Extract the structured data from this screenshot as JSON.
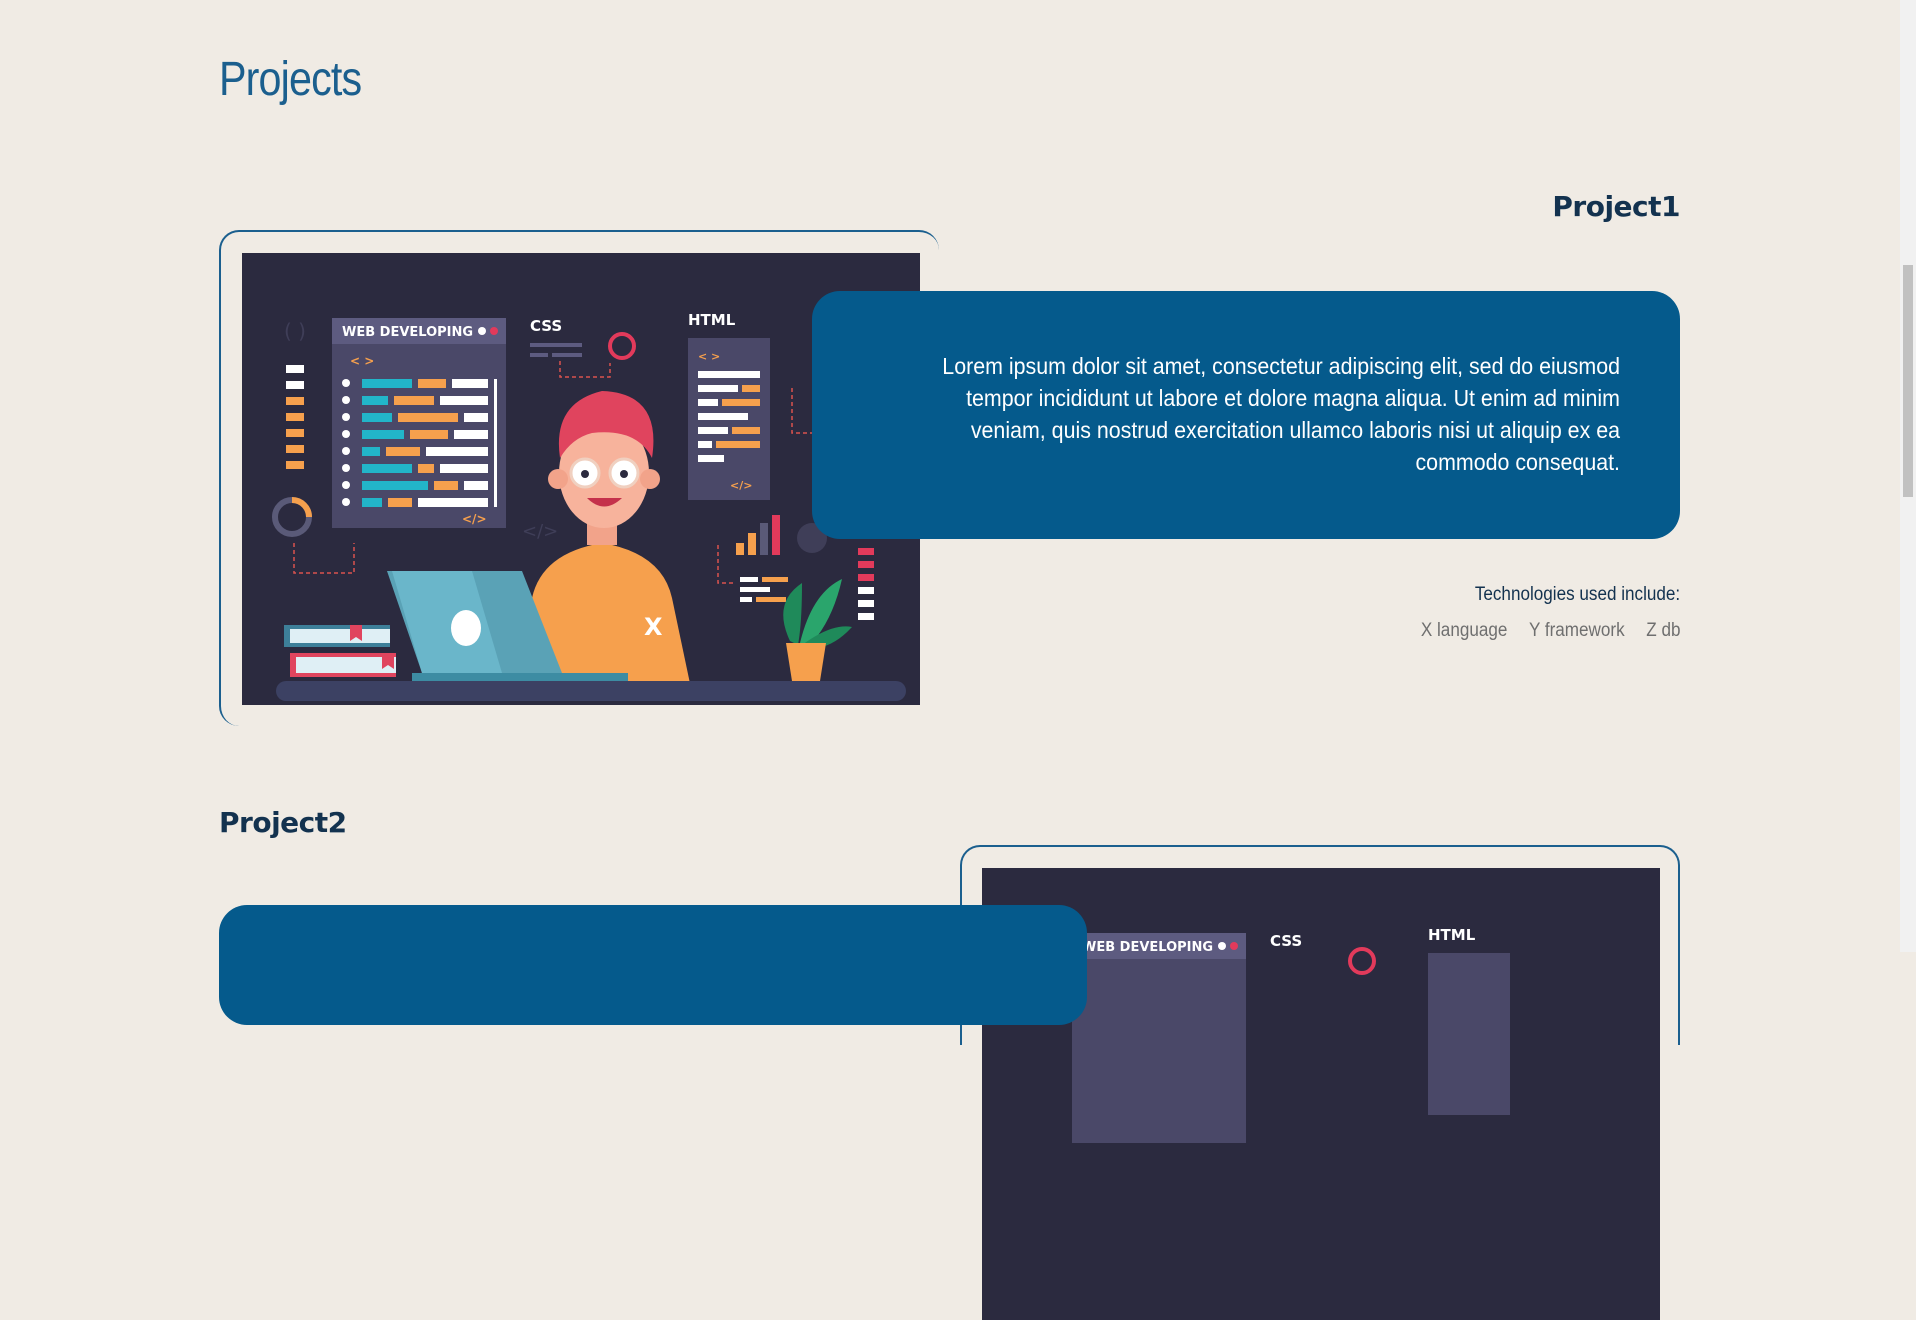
{
  "page": {
    "title": "Projects"
  },
  "projects": [
    {
      "title": "Project1",
      "description": "Lorem ipsum dolor sit amet, consectetur adipiscing elit, sed do eiusmod tempor incididunt ut labore et dolore magna aliqua. Ut enim ad minim veniam, quis nostrud exercitation ullamco laboris nisi ut aliquip ex ea commodo consequat.",
      "tech_label": "Technologies used include:",
      "technologies": [
        "X language",
        "Y framework",
        "Z db"
      ],
      "illustration": {
        "panel_title": "WEB DEVELOPING",
        "css_label": "CSS",
        "html_label": "HTML",
        "tag_open": "< >",
        "tag_close": "</>",
        "shirt_letter": "X"
      }
    },
    {
      "title": "Project2",
      "illustration": {
        "panel_title": "WEB DEVELOPING",
        "css_label": "CSS",
        "html_label": "HTML"
      }
    }
  ],
  "colors": {
    "background": "#f0ebe4",
    "accent": "#055a8c",
    "heading": "#13324f",
    "illustration_bg": "#2b2a3f"
  }
}
